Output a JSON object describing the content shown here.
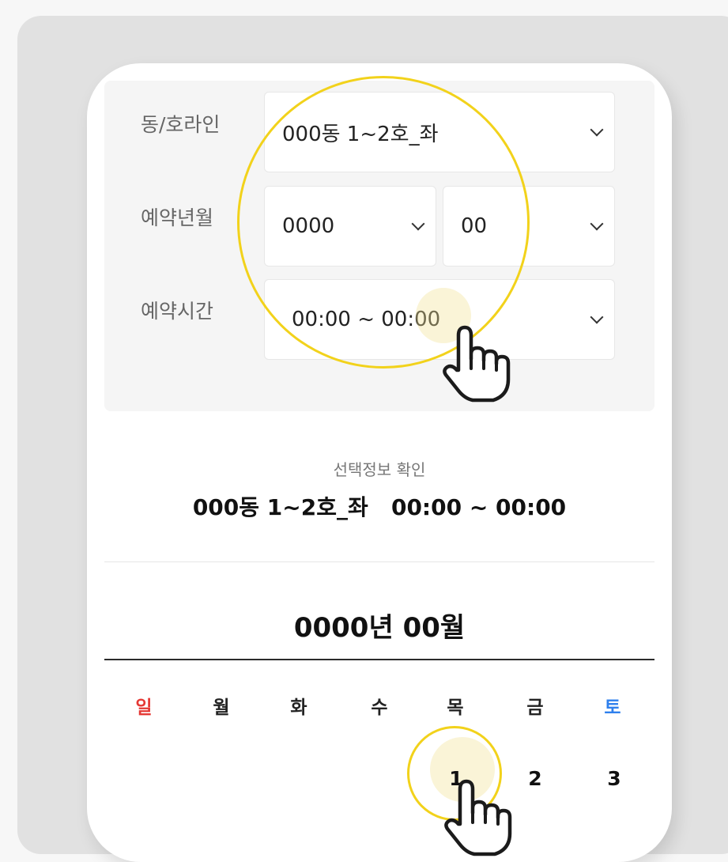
{
  "form": {
    "unit_line": {
      "label": "동/호라인",
      "value": "000동 1~2호_좌"
    },
    "reserve_month": {
      "label": "예약년월",
      "year_value": "0000",
      "month_value": "00"
    },
    "reserve_time": {
      "label": "예약시간",
      "value": "00:00 ~ 00:00"
    }
  },
  "confirm": {
    "label": "선택정보 확인",
    "value": "000동 1~2호_좌   00:00 ~ 00:00"
  },
  "calendar": {
    "title": "0000년 00월",
    "weekdays": [
      "일",
      "월",
      "화",
      "수",
      "목",
      "금",
      "토"
    ],
    "days": [
      "1",
      "2",
      "3"
    ]
  },
  "colors": {
    "highlight_ring": "#f2d21b",
    "sunday": "#e53935",
    "saturday": "#2f80ed"
  },
  "icons": [
    "pointing-hand-cursor-icon",
    "chevron-down-icon"
  ]
}
